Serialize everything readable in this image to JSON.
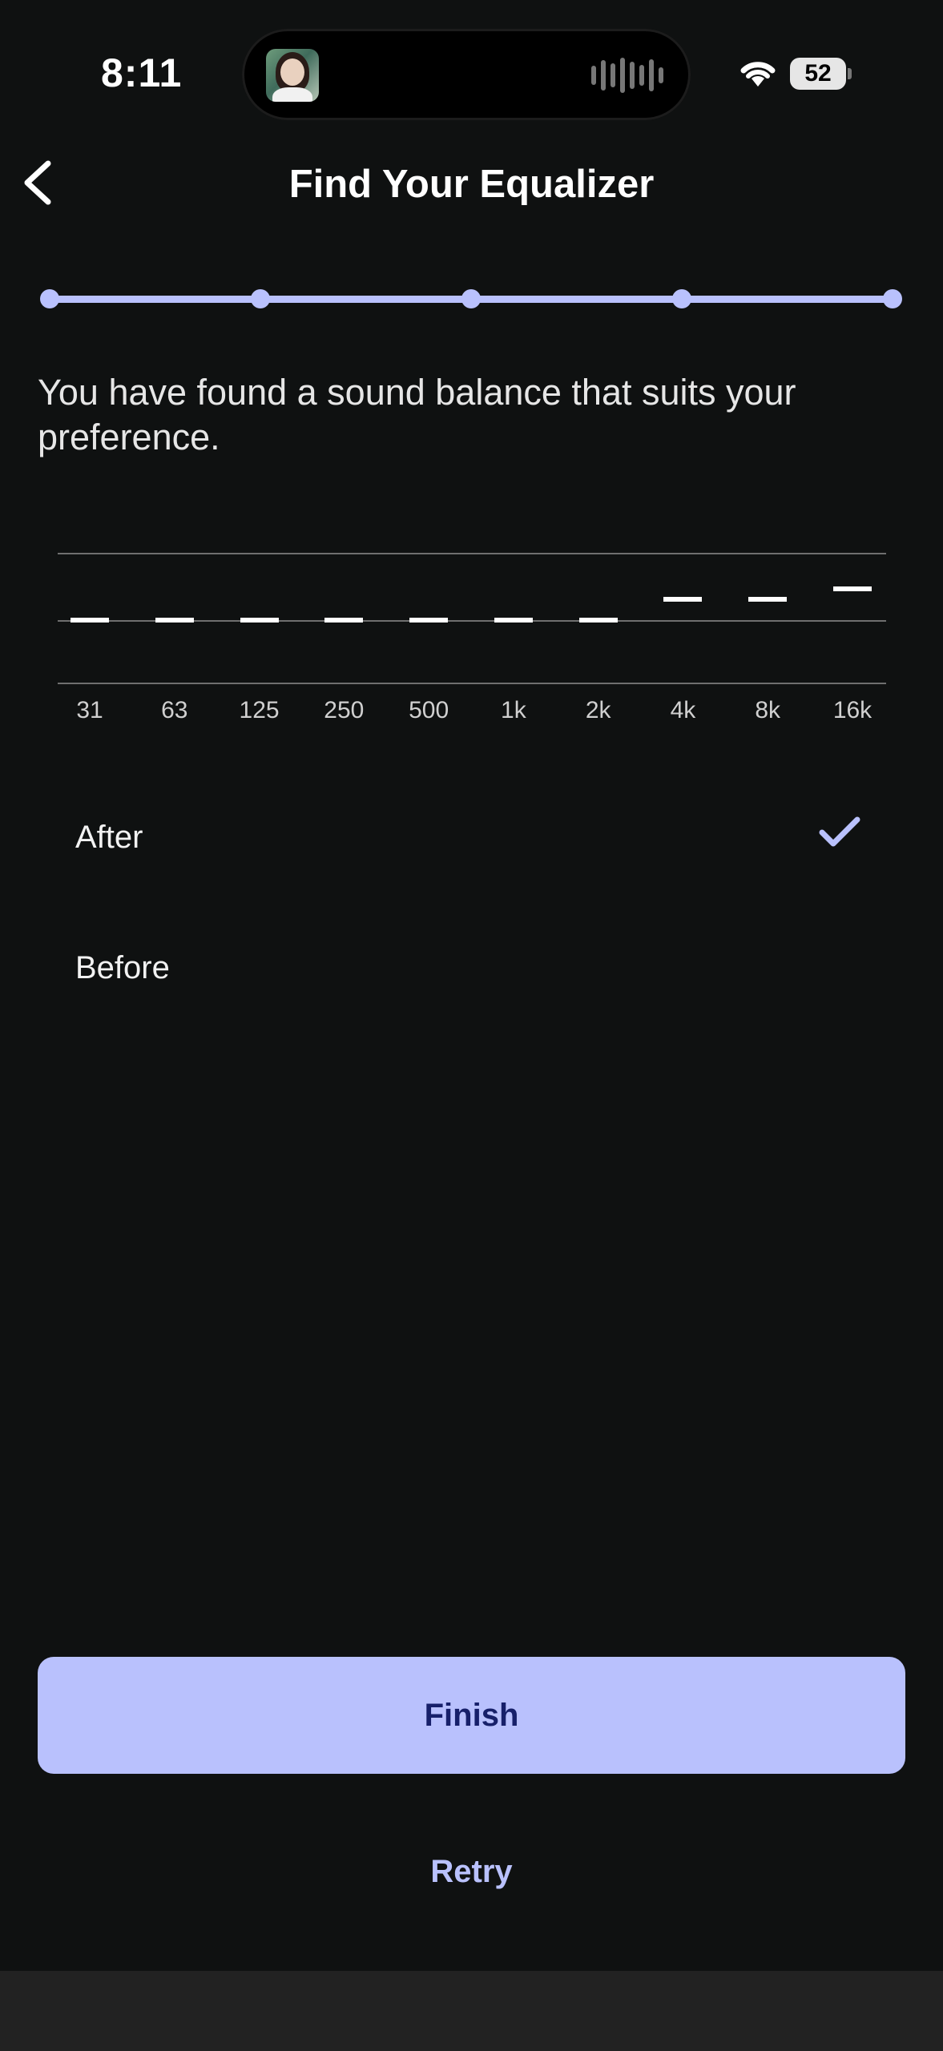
{
  "status_bar": {
    "time": "8:11",
    "battery": "52",
    "wifi_icon": "wifi-icon"
  },
  "header": {
    "back_icon": "chevron-left-icon",
    "title": "Find Your Equalizer"
  },
  "stepper": {
    "steps": 5,
    "current": 5,
    "color": "#b9c1fd"
  },
  "message": "You have found a sound balance that suits your preference.",
  "equalizer": {
    "bands": [
      {
        "label": "31",
        "level": 0
      },
      {
        "label": "63",
        "level": 0
      },
      {
        "label": "125",
        "level": 0
      },
      {
        "label": "250",
        "level": 0
      },
      {
        "label": "500",
        "level": 0
      },
      {
        "label": "1k",
        "level": 0
      },
      {
        "label": "2k",
        "level": 0
      },
      {
        "label": "4k",
        "level": 0.33
      },
      {
        "label": "8k",
        "level": 0.33
      },
      {
        "label": "16k",
        "level": 0.5
      }
    ],
    "level_range": [
      -1,
      1
    ]
  },
  "options": [
    {
      "label": "After",
      "selected": true
    },
    {
      "label": "Before",
      "selected": false
    }
  ],
  "buttons": {
    "finish": "Finish",
    "retry": "Retry"
  },
  "colors": {
    "accent": "#b9c1fd",
    "accent_text": "#17206a",
    "background": "#0f1111"
  }
}
